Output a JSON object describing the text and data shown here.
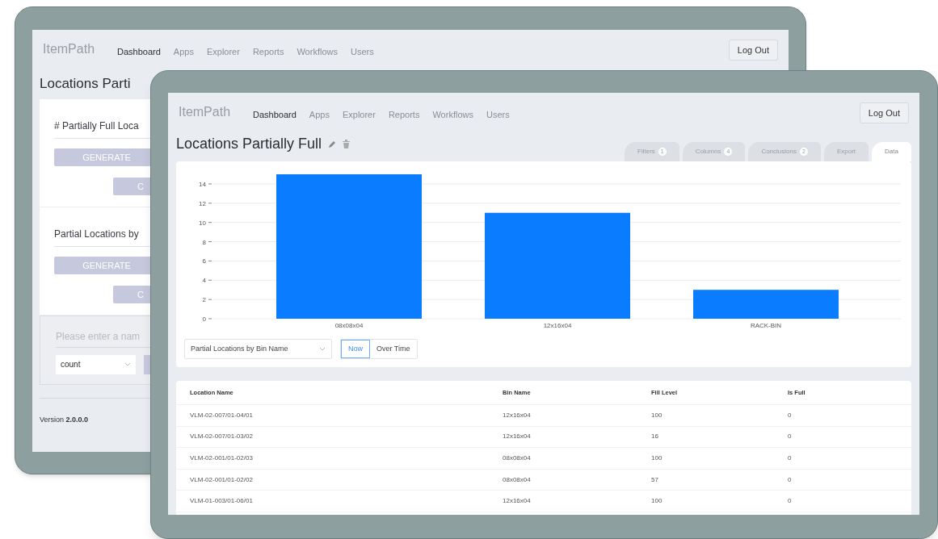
{
  "back_screen": {
    "logo": "ItemPath",
    "nav": [
      {
        "label": "Dashboard",
        "selected": true
      },
      {
        "label": "Apps",
        "selected": false
      },
      {
        "label": "Explorer",
        "selected": false
      },
      {
        "label": "Reports",
        "selected": false
      },
      {
        "label": "Workflows",
        "selected": false
      },
      {
        "label": "Users",
        "selected": false
      }
    ],
    "logout": "Log Out",
    "title": "Locations Parti",
    "sections": [
      {
        "title": "# Partially Full Loca",
        "generate": "GENERATE",
        "button_2": "C"
      },
      {
        "title": "Partial Locations by",
        "generate": "GENERATE",
        "button_2": "C"
      }
    ],
    "name_field": {
      "placeholder": "Please enter a nam"
    },
    "select": {
      "value": "count"
    },
    "version": "Version **2.0.0.0**"
  },
  "front_screen": {
    "logo": "ItemPath",
    "nav": [
      {
        "label": "Dashboard",
        "selected": true
      },
      {
        "label": "Apps",
        "selected": false
      },
      {
        "label": "Explorer",
        "selected": false
      },
      {
        "label": "Reports",
        "selected": false
      },
      {
        "label": "Workflows",
        "selected": false
      },
      {
        "label": "Users",
        "selected": false
      }
    ],
    "logout": "Log Out",
    "title": "Locations Partially Full",
    "tabs": [
      {
        "label": "Filters",
        "count": "1",
        "selected": false
      },
      {
        "label": "Columns",
        "count": "4",
        "selected": false
      },
      {
        "label": "Conclusions",
        "count": "2",
        "selected": false
      },
      {
        "label": "Export",
        "selected": false
      },
      {
        "label": "Data",
        "selected": true
      }
    ],
    "chart": {
      "chart_data": {
        "type": "bar",
        "categories": [
          "08x08x04",
          "12x16x04",
          "RACK-BIN"
        ],
        "series": [
          {
            "color": "#0a7cff",
            "values": [
              15,
              11,
              3
            ]
          }
        ],
        "ylim": [
          0,
          15
        ],
        "grid": true,
        "yticks": [
          0,
          2,
          4,
          6,
          8,
          10,
          12,
          14
        ]
      }
    },
    "chart_select": {
      "value": "Partial Locations by Bin Name"
    },
    "modes": [
      {
        "label": "Now",
        "selected": true
      },
      {
        "label": "Over Time",
        "selected": false
      }
    ],
    "table": {
      "columns": [
        "Location Name",
        "Bin Name",
        "Fill Level",
        "Is Full"
      ],
      "rows": [
        [
          "VLM-02-007/01-04/01",
          "12x16x04",
          "100",
          "0"
        ],
        [
          "VLM-02-007/01-03/02",
          "12x16x04",
          "16",
          "0"
        ],
        [
          "VLM-02-001/01-02/03",
          "08x08x04",
          "100",
          "0"
        ],
        [
          "VLM-02-001/01-02/02",
          "08x08x04",
          "57",
          "0"
        ],
        [
          "VLM-01-003/01-06/01",
          "12x16x04",
          "100",
          "0"
        ]
      ]
    }
  }
}
